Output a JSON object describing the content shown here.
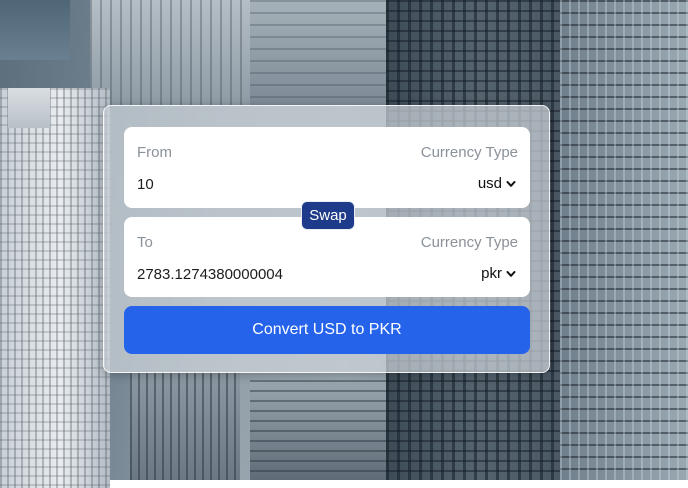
{
  "converter": {
    "from": {
      "label": "From",
      "currency_type_label": "Currency Type",
      "amount": "10",
      "currency": "usd"
    },
    "to": {
      "label": "To",
      "currency_type_label": "Currency Type",
      "amount": "2783.1274380000004",
      "currency": "pkr"
    },
    "swap_label": "Swap",
    "convert_label": "Convert USD to PKR"
  },
  "colors": {
    "swap_button": "#1e3a8a",
    "convert_button": "#2563eb",
    "label_text": "#8a9199"
  },
  "icons": {
    "select_arrow": "chevron-down-icon"
  }
}
